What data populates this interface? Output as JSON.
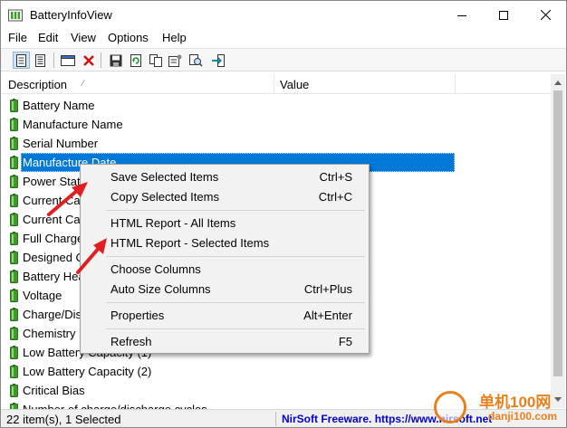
{
  "window": {
    "title": "BatteryInfoView"
  },
  "menu": [
    "File",
    "Edit",
    "View",
    "Options",
    "Help"
  ],
  "columns": {
    "description": "Description",
    "value": "Value"
  },
  "rows": [
    "Battery Name",
    "Manufacture Name",
    "Serial Number",
    "Manufacture Date",
    "Power State",
    "Current Capacity",
    "Current Capacity",
    "Full Charged Capacity",
    "Designed Capacity",
    "Battery Health",
    "Voltage",
    "Charge/Discharge Rate",
    "Chemistry",
    "Low Battery Capacity (1)",
    "Low Battery Capacity (2)",
    "Critical Bias",
    "Number of charge/discharge cycles"
  ],
  "selected_row_index": 3,
  "context_menu": {
    "items": [
      {
        "label": "Save Selected Items",
        "shortcut": "Ctrl+S"
      },
      {
        "label": "Copy Selected Items",
        "shortcut": "Ctrl+C"
      },
      {
        "label": "HTML Report - All Items",
        "shortcut": ""
      },
      {
        "label": "HTML Report - Selected Items",
        "shortcut": ""
      },
      {
        "label": "Choose Columns",
        "shortcut": ""
      },
      {
        "label": "Auto Size Columns",
        "shortcut": "Ctrl+Plus"
      },
      {
        "label": "Properties",
        "shortcut": "Alt+Enter"
      },
      {
        "label": "Refresh",
        "shortcut": "F5"
      }
    ]
  },
  "status": {
    "count": "22 item(s), 1 Selected",
    "link": "NirSoft Freeware. https://www.nirsoft.net"
  },
  "watermark": {
    "line1": "单机100网",
    "line2": "danji100.com"
  },
  "colors": {
    "selection": "#0078d7",
    "battery_green": "#3e9b2a",
    "arrow_red": "#e02020",
    "link_blue": "#0000cc",
    "watermark_orange": "#e8811d"
  },
  "icons": [
    "app-icon",
    "minimize-icon",
    "maximize-icon",
    "close-icon",
    "battery-icon",
    "toolbar-icons"
  ]
}
